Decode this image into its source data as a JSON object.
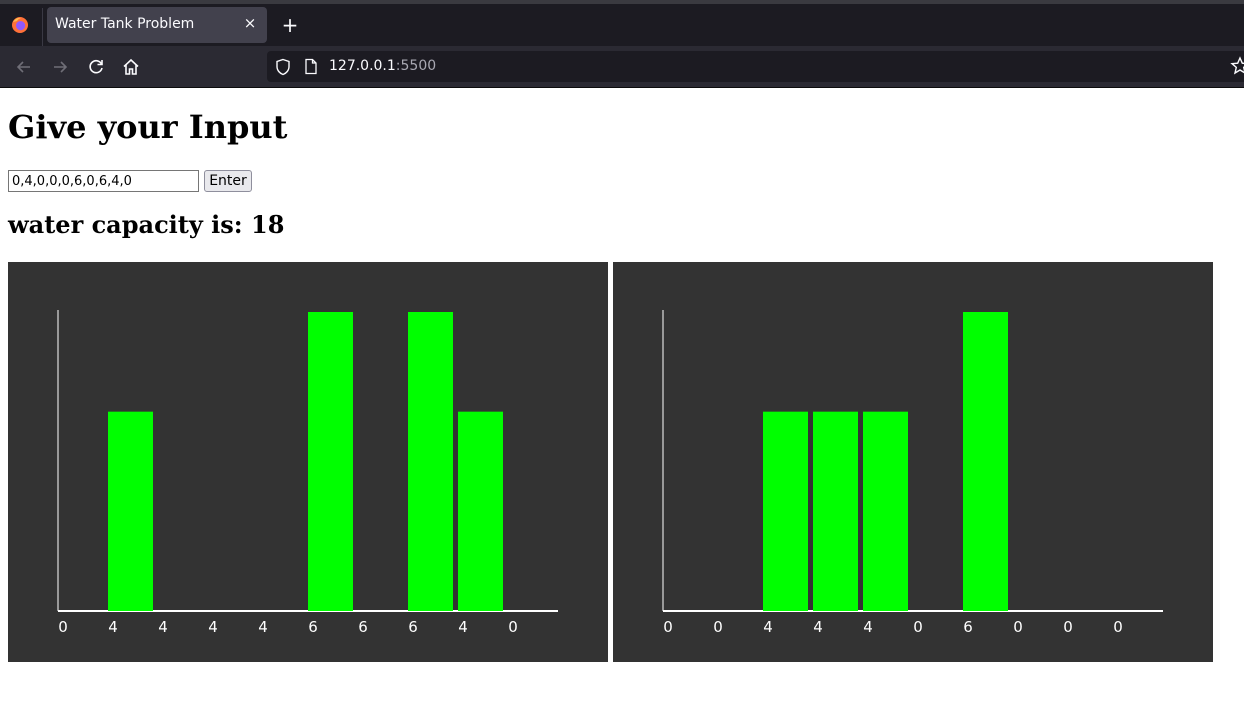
{
  "browser": {
    "tab_title": "Water Tank Problem",
    "tab_close": "×",
    "new_tab": "+",
    "url_host": "127.0.0.1",
    "url_port": ":5500",
    "icons": [
      "firefox-logo-icon",
      "back-arrow-icon",
      "forward-arrow-icon",
      "reload-icon",
      "home-icon",
      "shield-icon",
      "page-icon",
      "bookmark-star-icon"
    ]
  },
  "page": {
    "heading": "Give your Input",
    "input_value": "0,4,0,0,0,6,0,6,4,0",
    "enter_label": "Enter",
    "result_text": "water capacity is: 18"
  },
  "colors": {
    "bar": "#00ff00",
    "panel_background": "#333333",
    "axis": "#ffffff"
  },
  "chart_data": [
    {
      "type": "bar",
      "categories": [
        "0",
        "4",
        "4",
        "4",
        "4",
        "6",
        "6",
        "6",
        "4",
        "0"
      ],
      "values": [
        0,
        4,
        0,
        0,
        0,
        6,
        0,
        6,
        4,
        0
      ],
      "ylim": [
        0,
        6
      ],
      "grid": false,
      "bar_color": "#00ff00"
    },
    {
      "type": "bar",
      "categories": [
        "0",
        "0",
        "4",
        "4",
        "4",
        "0",
        "6",
        "0",
        "0",
        "0"
      ],
      "values": [
        0,
        0,
        4,
        4,
        4,
        0,
        6,
        0,
        0,
        0
      ],
      "ylim": [
        0,
        6
      ],
      "grid": false,
      "bar_color": "#00ff00"
    }
  ]
}
